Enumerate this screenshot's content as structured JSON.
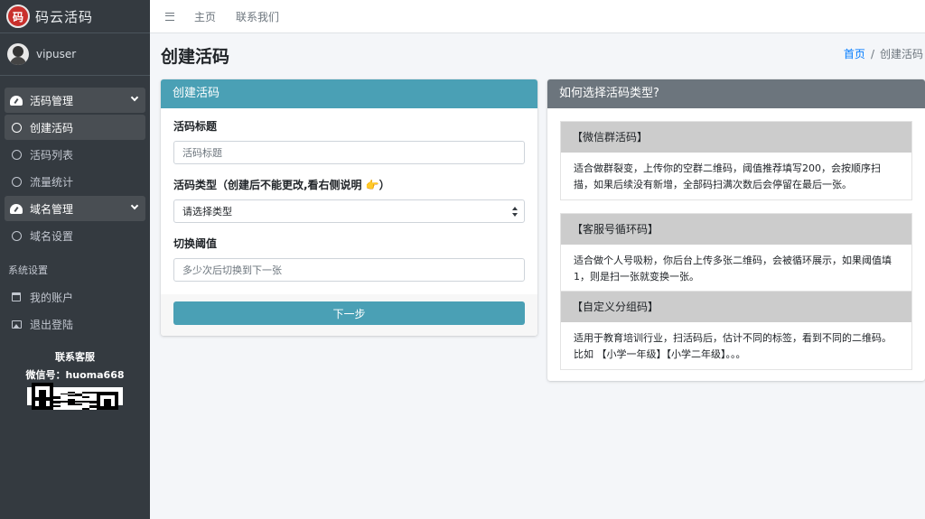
{
  "brand": {
    "logo_text": "码",
    "name": "码云活码"
  },
  "user": {
    "name": "vipuser"
  },
  "sidebar": {
    "groups": [
      {
        "label": "活码管理",
        "items": [
          "创建活码",
          "活码列表",
          "流量统计"
        ]
      },
      {
        "label": "域名管理",
        "items": [
          "域名设置"
        ]
      }
    ],
    "section_header": "系统设置",
    "system_items": [
      "我的账户",
      "退出登陆"
    ],
    "contact_title": "联系客服",
    "contact_wechat": "微信号：huoma668"
  },
  "topnav": {
    "links": [
      "主页",
      "联系我们"
    ]
  },
  "page": {
    "title": "创建活码",
    "breadcrumb": {
      "home": "首页",
      "sep": "/",
      "current": "创建活码"
    }
  },
  "form": {
    "header": "创建活码",
    "title_label": "活码标题",
    "title_placeholder": "活码标题",
    "type_label": "活码类型（创建后不能更改,看右侧说明 👉）",
    "type_selected": "请选择类型",
    "threshold_label": "切换阈值",
    "threshold_placeholder": "多少次后切换到下一张",
    "next_button": "下一步"
  },
  "guide": {
    "header": "如何选择活码类型?",
    "types": [
      {
        "name": "【微信群活码】",
        "desc": "适合做群裂变，上传你的空群二维码，阈值推荐填写200，会按顺序扫描，如果后续没有新增，全部码扫满次数后会停留在最后一张。"
      },
      {
        "name": "【客服号循环码】",
        "desc": "适合做个人号吸粉，你后台上传多张二维码，会被循环展示，如果阈值填1，则是扫一张就变换一张。"
      },
      {
        "name": "【自定义分组码】",
        "desc": "适用于教育培训行业，扫活码后，估计不同的标签，看到不同的二维码。比如 【小学一年级】【小学二年级】。。。"
      }
    ]
  },
  "colors": {
    "sidebar_bg": "#343a40",
    "primary_info": "#4aa0b5",
    "secondary": "#6c757d",
    "link": "#007bff"
  }
}
